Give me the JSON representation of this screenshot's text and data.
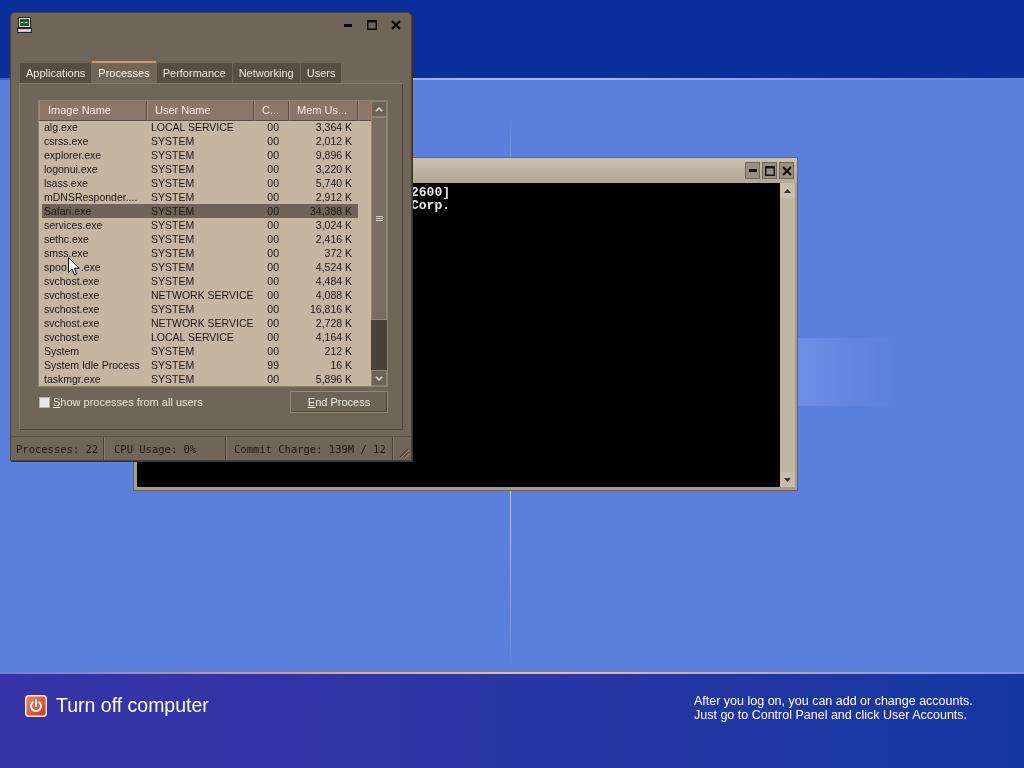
{
  "task_manager": {
    "tabs": [
      {
        "label": "Applications",
        "selected": false
      },
      {
        "label": "Processes",
        "selected": true
      },
      {
        "label": "Performance",
        "selected": false
      },
      {
        "label": "Networking",
        "selected": false
      },
      {
        "label": "Users",
        "selected": false
      }
    ],
    "columns": [
      "Image Name",
      "User Name",
      "C...",
      "Mem Us..."
    ],
    "rows": [
      {
        "cells": [
          "alg.exe",
          "LOCAL SERVICE",
          "00",
          "3,364 K"
        ],
        "selected": false
      },
      {
        "cells": [
          "csrss.exe",
          "SYSTEM",
          "00",
          "2,012 K"
        ],
        "selected": false
      },
      {
        "cells": [
          "explorer.exe",
          "SYSTEM",
          "00",
          "9,896 K"
        ],
        "selected": false
      },
      {
        "cells": [
          "logonui.exe",
          "SYSTEM",
          "00",
          "3,220 K"
        ],
        "selected": false
      },
      {
        "cells": [
          "lsass.exe",
          "SYSTEM",
          "00",
          "5,740 K"
        ],
        "selected": false
      },
      {
        "cells": [
          "mDNSResponder....",
          "SYSTEM",
          "00",
          "2,912 K"
        ],
        "selected": false
      },
      {
        "cells": [
          "Safari.exe",
          "SYSTEM",
          "00",
          "34,388 K"
        ],
        "selected": true
      },
      {
        "cells": [
          "services.exe",
          "SYSTEM",
          "00",
          "3,024 K"
        ],
        "selected": false
      },
      {
        "cells": [
          "sethc.exe",
          "SYSTEM",
          "00",
          "2,416 K"
        ],
        "selected": false
      },
      {
        "cells": [
          "smss.exe",
          "SYSTEM",
          "00",
          "372 K"
        ],
        "selected": false
      },
      {
        "cells": [
          [
            "spoo",
            ".exe"
          ],
          "SYSTEM",
          "00",
          "4,524 K"
        ],
        "selected": false
      },
      {
        "cells": [
          "svchost.exe",
          "SYSTEM",
          "00",
          "4,484 K"
        ],
        "selected": false
      },
      {
        "cells": [
          "svchost.exe",
          "NETWORK SERVICE",
          "00",
          "4,088 K"
        ],
        "selected": false
      },
      {
        "cells": [
          "svchost.exe",
          "SYSTEM",
          "00",
          "16,816 K"
        ],
        "selected": false
      },
      {
        "cells": [
          "svchost.exe",
          "NETWORK SERVICE",
          "00",
          "2,728 K"
        ],
        "selected": false
      },
      {
        "cells": [
          "svchost.exe",
          "LOCAL SERVICE",
          "00",
          "4,164 K"
        ],
        "selected": false
      },
      {
        "cells": [
          "System",
          "SYSTEM",
          "00",
          "212 K"
        ],
        "selected": false
      },
      {
        "cells": [
          "System Idle Process",
          "SYSTEM",
          "99",
          "16 K"
        ],
        "selected": false
      },
      {
        "cells": [
          "taskmgr.exe",
          "SYSTEM",
          "00",
          "5,896 K"
        ],
        "selected": false
      }
    ],
    "show_all_users": {
      "label": "Show processes from all users",
      "checked": false
    },
    "end_button": "End Process",
    "status_bar": [
      "Processes: 22",
      "CPU Usage: 0%",
      "Commit Charge: 139M / 12"
    ]
  },
  "console": {
    "lines": [
      "2600]",
      "Corp."
    ]
  },
  "bottom_bar": {
    "turn_off_label": "Turn off computer",
    "help_lines": [
      "After you log on, you can add or change accounts.",
      "Just go to Control Panel and click User Accounts."
    ]
  }
}
